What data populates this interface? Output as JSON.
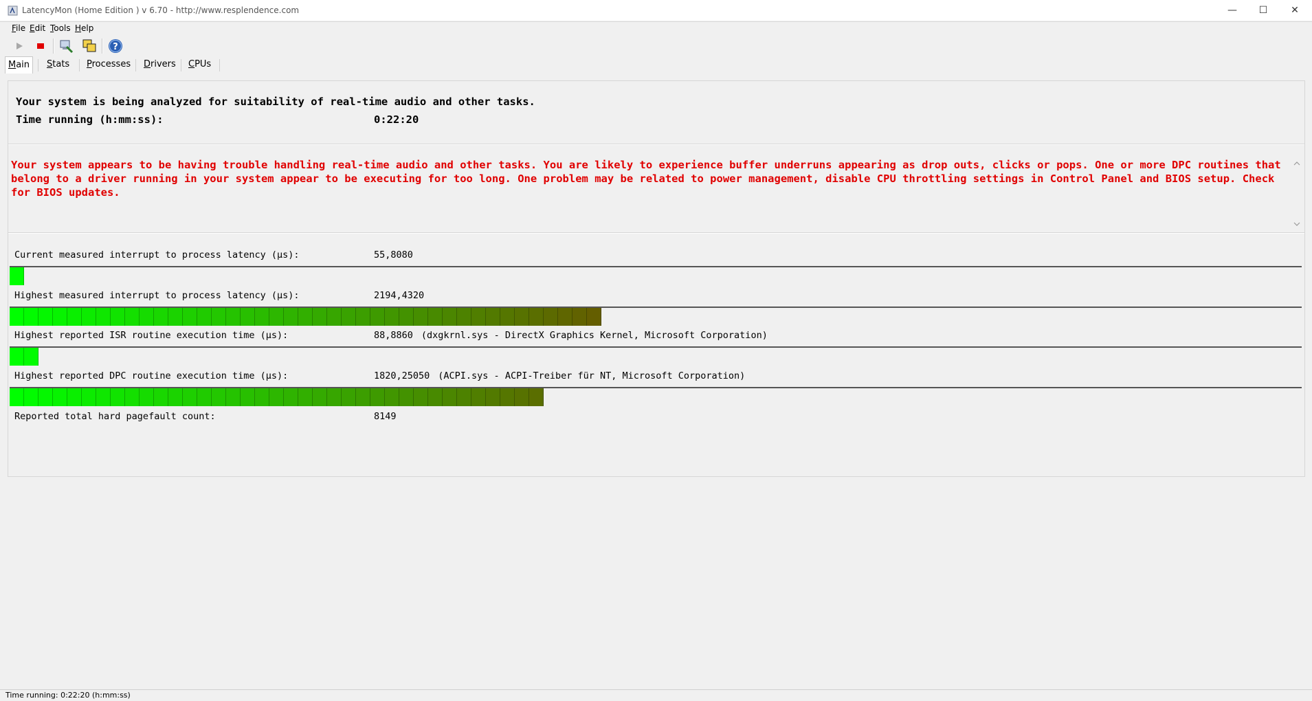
{
  "window": {
    "title": "LatencyMon  (Home Edition )  v 6.70 - http://www.resplendence.com",
    "min_glyph": "—",
    "max_glyph": "☐",
    "close_glyph": "✕"
  },
  "menu": [
    {
      "key": "F",
      "rest": "ile"
    },
    {
      "key": "E",
      "rest": "dit"
    },
    {
      "key": "T",
      "rest": "ools"
    },
    {
      "key": "H",
      "rest": "elp"
    }
  ],
  "toolbar": {
    "play_icon": "play-icon",
    "stop_icon": "stop-icon",
    "help_glyph": "?"
  },
  "tabs": [
    {
      "key": "M",
      "rest": "ain",
      "active": true
    },
    {
      "key": "S",
      "rest": "tats"
    },
    {
      "key": "P",
      "rest": "rocesses"
    },
    {
      "key": "D",
      "rest": "rivers"
    },
    {
      "key": "C",
      "rest": "PUs"
    }
  ],
  "main": {
    "analysis_line": "Your system is being analyzed for suitability of real-time audio and other tasks.",
    "time_label": "Time running (h:mm:ss):",
    "time_value": "0:22:20",
    "warning": "Your system appears to be having trouble handling real-time audio and other tasks. You are likely to experience buffer underruns appearing as drop outs, clicks or pops. One or more DPC routines that belong to a driver running in your system appear to be executing for too long. One problem may be related to power management, disable CPU throttling settings in Control Panel and BIOS setup. Check for BIOS updates.",
    "metrics": [
      {
        "label": "Current measured interrupt to process latency (µs):",
        "value": "55,8080",
        "driver": "",
        "level": 0.0115
      },
      {
        "label": "Highest measured interrupt to process latency (µs):",
        "value": "2194,4320",
        "driver": "",
        "level": 0.456
      },
      {
        "label": "Highest reported ISR routine execution time (µs):",
        "value": "88,8860",
        "driver": "(dxgkrnl.sys - DirectX Graphics Kernel, Microsoft Corporation)",
        "level": 0.0228
      },
      {
        "label": "Highest reported DPC routine execution time (µs):",
        "value": "1820,25050",
        "driver": "(ACPI.sys - ACPI-Treiber für NT, Microsoft Corporation)",
        "level": 0.42
      }
    ],
    "pagefault_label": "Reported total hard pagefault count:",
    "pagefault_value": "8149"
  },
  "status": {
    "text": "Time running: 0:22:20  (h:mm:ss)"
  },
  "colors": {
    "warning": "#e00000",
    "bar_start": "#00ff00",
    "bar_end": "#7a3a00"
  }
}
